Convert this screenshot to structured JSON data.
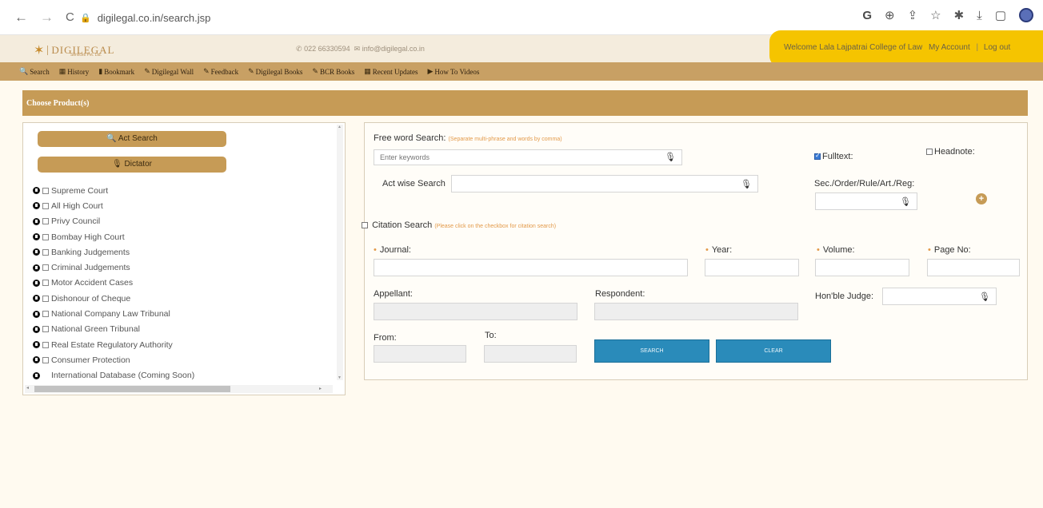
{
  "browser": {
    "url": "digilegal.co.in/search.jsp",
    "back_icon": "←",
    "forward_icon": "→",
    "reload_icon": "C"
  },
  "header": {
    "logo_text": "DIGILEGAL",
    "logo_sub": "Services Pvt. Ltd.",
    "phone": "022 66330594",
    "email": "info@digilegal.co.in",
    "welcome": "Welcome Lala Lajpatrai College of Law",
    "my_account": "My Account",
    "logout": "Log out"
  },
  "menu": [
    {
      "icon": "🔍",
      "label": "Search"
    },
    {
      "icon": "▦",
      "label": "History"
    },
    {
      "icon": "▮",
      "label": "Bookmark"
    },
    {
      "icon": "✎",
      "label": "Digilegal Wall"
    },
    {
      "icon": "✎",
      "label": "Feedback"
    },
    {
      "icon": "✎",
      "label": "Digilegal Books"
    },
    {
      "icon": "✎",
      "label": "BCR Books"
    },
    {
      "icon": "▦",
      "label": "Recent Updates"
    },
    {
      "icon": "▶",
      "label": "How To Videos"
    }
  ],
  "choose_products": "Choose Product(s)",
  "left": {
    "act_search": "🔍 Act Search",
    "dictator": "🎙 Dictator",
    "courts": [
      "Supreme Court",
      "All High Court",
      "Privy Council",
      "Bombay High Court",
      "Banking Judgements",
      "Criminal Judgements",
      "Motor Accident Cases",
      "Dishonour of Cheque",
      "National Company Law Tribunal",
      "National Green Tribunal",
      "Real Estate Regulatory Authority",
      "Consumer Protection",
      "International Database (Coming Soon)"
    ]
  },
  "form": {
    "free_word_label": "Free word Search:",
    "free_word_hint": "(Separate multi-phrase and words by comma)",
    "keywords_placeholder": "Enter keywords",
    "fulltext": "Fulltext:",
    "headnote": "Headnote:",
    "act_wise": "Act wise Search",
    "sec_label": "Sec./Order/Rule/Art./Reg:",
    "citation_label": "Citation Search",
    "citation_hint": "(Please click on the checkbox for citation search)",
    "journal": "Journal:",
    "year": "Year:",
    "volume": "Volume:",
    "page_no": "Page No:",
    "appellant": "Appellant:",
    "respondent": "Respondent:",
    "judge": "Hon'ble Judge:",
    "from": "From:",
    "to": "To:",
    "search_btn": "SEARCH",
    "clear_btn": "CLEAR"
  }
}
